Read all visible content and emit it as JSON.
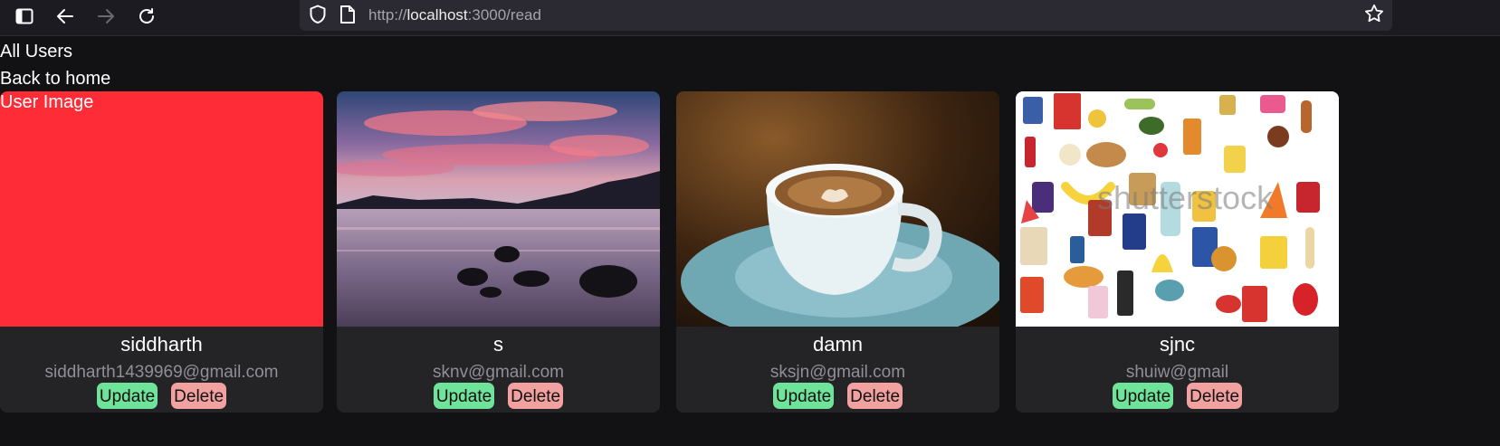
{
  "browser": {
    "url_scheme": "http://",
    "url_host": "localhost",
    "url_rest": ":3000/read"
  },
  "page": {
    "title": "All Users",
    "back_link": "Back to home"
  },
  "users": [
    {
      "name": "siddharth",
      "email": "siddharth1439969@gmail.com",
      "image_alt": "User Image",
      "image": "broken (alt text shown)"
    },
    {
      "name": "s",
      "email": "sknv@gmail.com",
      "image": "sunset over lake with rocks"
    },
    {
      "name": "damn",
      "email": "sksjn@gmail.com",
      "image": "coffee cup on saucer"
    },
    {
      "name": "sjnc",
      "email": "shuiw@gmail",
      "image": "grocery items pattern",
      "watermark": "shutterstock"
    }
  ],
  "buttons": {
    "update": "Update",
    "delete": "Delete"
  },
  "colors": {
    "background": "#121214",
    "card": "#242427",
    "broken_image": "#fe2c36",
    "update": "#6fe39a",
    "delete": "#f2a1a1"
  }
}
